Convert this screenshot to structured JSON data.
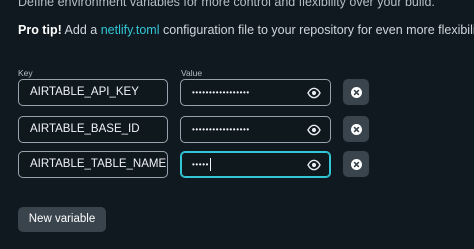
{
  "intro": {
    "text": "Define environment variables for more control and flexibility over your build."
  },
  "protip": {
    "label": "Pro tip!",
    "before": " Add a ",
    "file": "netlify.toml",
    "after": " configuration file to your repository for even more flexibility."
  },
  "columns": {
    "key": "Key",
    "value": "Value"
  },
  "rows": [
    {
      "key": "AIRTABLE_API_KEY",
      "value_masked": "•••••••••••••••••"
    },
    {
      "key": "AIRTABLE_BASE_ID",
      "value_masked": "•••••••••••••••••"
    },
    {
      "key": "AIRTABLE_TABLE_NAME",
      "value_masked": "•••••"
    }
  ],
  "actions": {
    "new_variable": "New variable"
  },
  "colors": {
    "background": "#10191f",
    "accent_teal": "#32c6d6",
    "field_border": "#9aa3ad",
    "button_bg": "#3a444d"
  },
  "icons": {
    "reveal": "eye-icon",
    "remove": "close-circle-icon"
  }
}
